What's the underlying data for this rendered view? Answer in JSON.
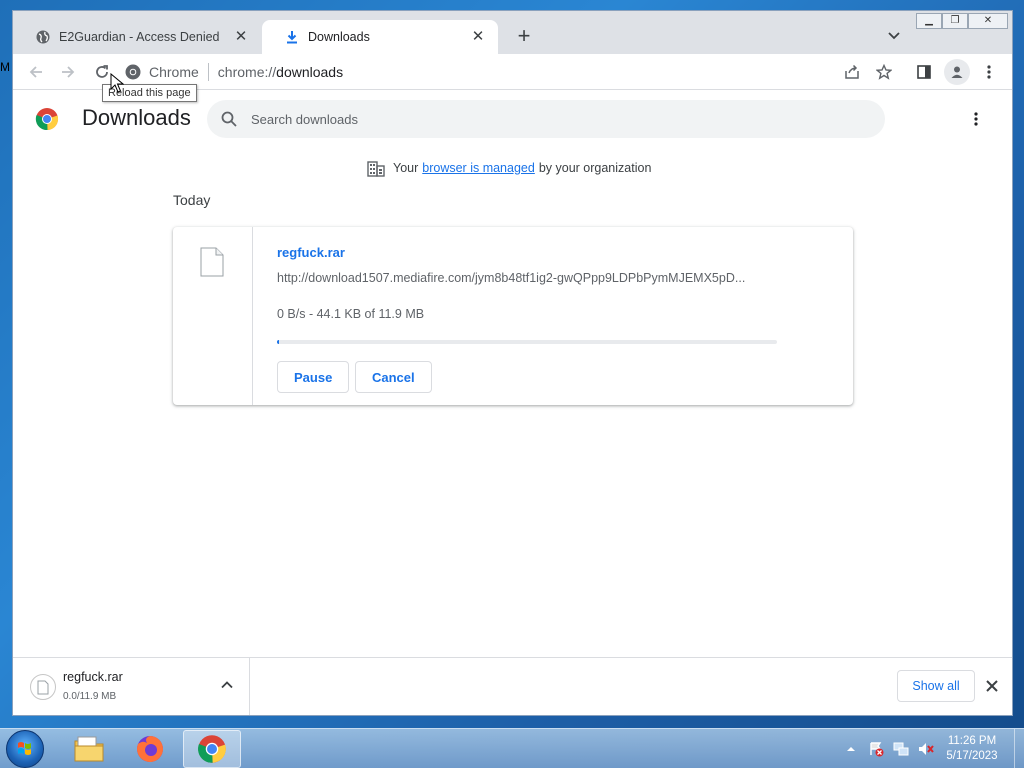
{
  "desktop": {
    "edge_text": "M"
  },
  "browser": {
    "tabs": [
      {
        "title": "E2Guardian - Access Denied",
        "icon": "globe-icon",
        "active": false
      },
      {
        "title": "Downloads",
        "icon": "download-icon",
        "active": true
      }
    ],
    "window_controls": {
      "minimize": "▁",
      "restore": "❐",
      "close": "✕"
    },
    "toolbar": {
      "site_name": "Chrome",
      "url_scheme": "chrome://",
      "url_host": "downloads"
    },
    "tooltip": "Reload this page"
  },
  "downloads_page": {
    "title": "Downloads",
    "search_placeholder": "Search downloads",
    "managed_notice": {
      "prefix": "Your",
      "link": "browser is managed",
      "suffix": "by your organization"
    },
    "date_group": "Today",
    "item": {
      "file_name": "regfuck.rar",
      "url": "http://download1507.mediafire.com/jym8b48tf1ig2-gwQPpp9LDPbPymMJEMX5pD...",
      "status": "0 B/s - 44.1 KB of 11.9 MB",
      "progress_fraction": 0.004,
      "pause_label": "Pause",
      "cancel_label": "Cancel"
    }
  },
  "download_shelf": {
    "file_name": "regfuck.rar",
    "sub_status": "0.0/11.9 MB",
    "show_all_label": "Show all"
  },
  "taskbar": {
    "apps": [
      "explorer-icon",
      "firefox-icon",
      "chrome-icon"
    ],
    "active_app": "chrome-icon",
    "clock_time": "11:26 PM",
    "clock_date": "5/17/2023"
  },
  "colors": {
    "accent": "#1a73e8",
    "tab_strip": "#dee1e6"
  }
}
